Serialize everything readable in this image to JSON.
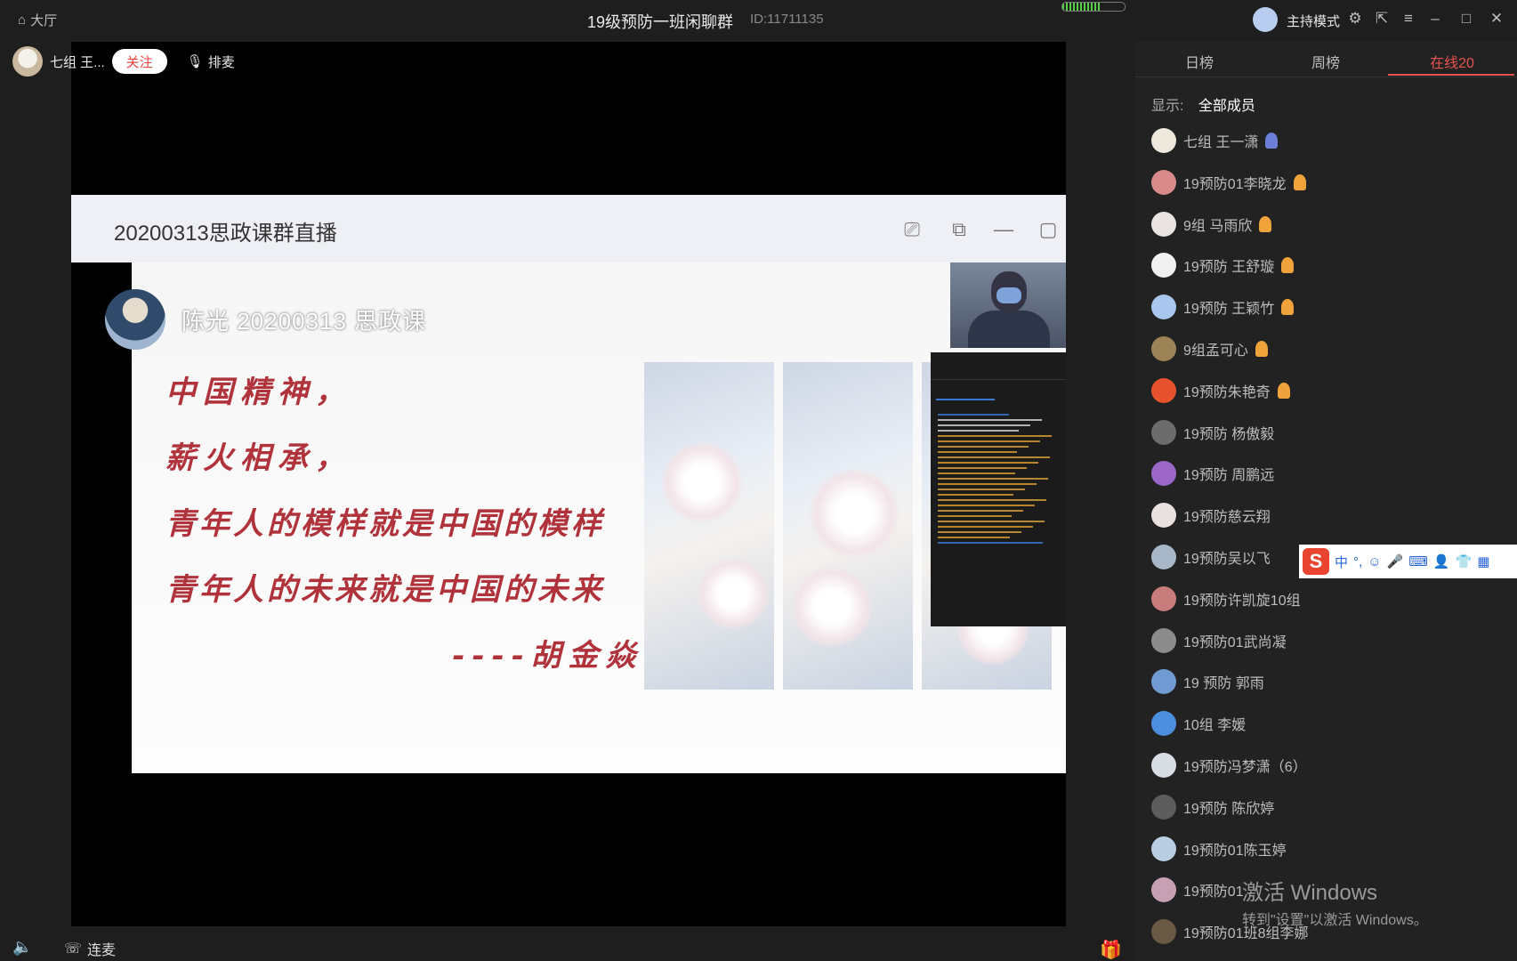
{
  "topbar": {
    "home_label": "大厅",
    "title": "19级预防一班闲聊群",
    "room_id": "ID:11711135",
    "host_mode": "主持模式",
    "signal_level": 0.6
  },
  "presenter": {
    "name": "七组 王...",
    "follow_label": "关注",
    "queue_label": "排麦"
  },
  "share": {
    "title": "20200313思政课群直播"
  },
  "slide": {
    "label": "陈光 20200313 思政课",
    "lines": [
      "中国精神，",
      "薪火相承，",
      "青年人的模样就是中国的模样",
      "青年人的未来就是中国的未来",
      "----胡金焱"
    ]
  },
  "bottom": {
    "mic_label": "连麦"
  },
  "right_panel": {
    "tabs": [
      "日榜",
      "周榜",
      "在线20"
    ],
    "filter_label": "显示:",
    "filter_value": "全部成员",
    "members": [
      {
        "name": "七组 王一潇",
        "avatar": "#efe8dc",
        "badge": "#6b7fd6"
      },
      {
        "name": "19预防01李晓龙",
        "avatar": "#d98b8b",
        "badge": "#f0a33a"
      },
      {
        "name": "9组 马雨欣",
        "avatar": "#e9e3e1",
        "badge": "#f0a33a"
      },
      {
        "name": "19预防 王舒璇",
        "avatar": "#f1f1f1",
        "badge": "#f0a33a"
      },
      {
        "name": "19预防 王颖竹",
        "avatar": "#a9c6ee",
        "badge": "#f0a33a"
      },
      {
        "name": "9组孟可心",
        "avatar": "#9c8456",
        "badge": "#f0a33a"
      },
      {
        "name": "19预防朱艳奇",
        "avatar": "#e6512e",
        "badge": "#f0a33a"
      },
      {
        "name": "19预防 杨傲毅",
        "avatar": "#6c6c6c",
        "badge": ""
      },
      {
        "name": "19预防 周鹏远",
        "avatar": "#9d67c8",
        "badge": ""
      },
      {
        "name": "19预防慈云翔",
        "avatar": "#e9e0e0",
        "badge": ""
      },
      {
        "name": "19预防吴以飞",
        "avatar": "#a7b7c8",
        "badge": ""
      },
      {
        "name": "19预防许凯旋10组",
        "avatar": "#c97c7c",
        "badge": ""
      },
      {
        "name": "19预防01武尚凝",
        "avatar": "#8b8b8b",
        "badge": ""
      },
      {
        "name": "19 预防 郭雨",
        "avatar": "#6f9bd2",
        "badge": ""
      },
      {
        "name": "10组 李媛",
        "avatar": "#4c8fdf",
        "badge": ""
      },
      {
        "name": "19预防冯梦潇（6）",
        "avatar": "#d8dde3",
        "badge": ""
      },
      {
        "name": "19预防 陈欣婷",
        "avatar": "#5d5d5d",
        "badge": ""
      },
      {
        "name": "19预防01陈玉婷",
        "avatar": "#b9cde3",
        "badge": ""
      },
      {
        "name": "19预防01",
        "avatar": "#c8a0b4",
        "badge": ""
      },
      {
        "name": "19预防01班8组李娜",
        "avatar": "#6a5a45",
        "badge": ""
      }
    ]
  },
  "ime": {
    "logo": "S",
    "mode": "中"
  },
  "watermark": {
    "line1": "激活 Windows",
    "line2": "转到\"设置\"以激活 Windows。"
  }
}
